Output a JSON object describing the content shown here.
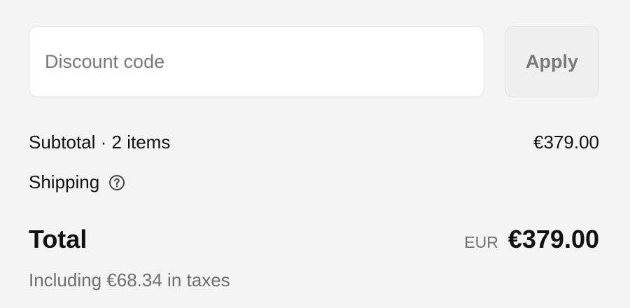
{
  "discount": {
    "placeholder": "Discount code",
    "value": "",
    "apply_label": "Apply"
  },
  "summary": {
    "subtotal_label": "Subtotal · 2 items",
    "subtotal_value": "€379.00",
    "shipping_label": "Shipping",
    "shipping_help_icon": "help-circle-icon",
    "total_label": "Total",
    "currency_code": "EUR",
    "total_value": "€379.00",
    "taxes_note": "Including €68.34 in taxes"
  },
  "colors": {
    "background": "#f4f4f4",
    "text": "#111111",
    "muted_text": "#707070",
    "input_background": "#ffffff",
    "button_background": "#efefef"
  }
}
